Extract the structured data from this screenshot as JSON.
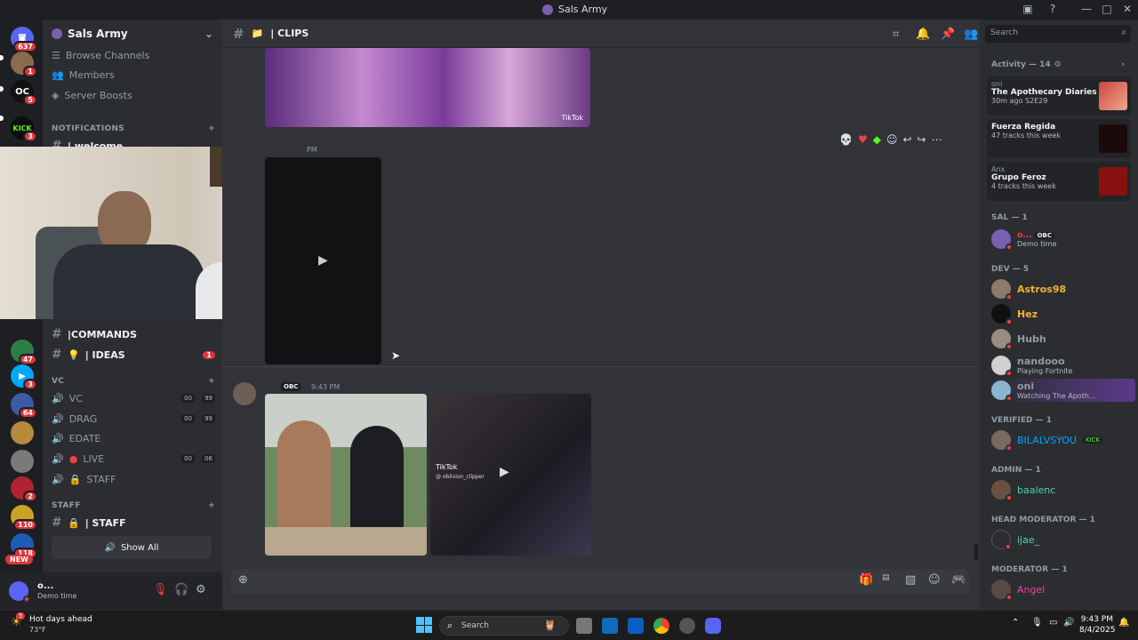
{
  "window": {
    "title": "Sals Army"
  },
  "server_badges": [
    "637",
    "1",
    "5",
    "3",
    "47",
    "3",
    "64",
    "2",
    "110",
    "118"
  ],
  "server_new_label": "NEW",
  "server": {
    "name": "Sals Army"
  },
  "nav": {
    "browse": "Browse Channels",
    "members": "Members",
    "boosts": "Server Boosts"
  },
  "categories": {
    "notifications": "NOTIFICATIONS",
    "vc": "VC",
    "staff": "STAFF"
  },
  "channels": {
    "welcome": "| welcome",
    "commands": "|COMMANDS",
    "ideas": "| IDEAS",
    "ideas_badge": "1",
    "vc": "VC",
    "drag": "DRAG",
    "edate": "EDATE",
    "live": "LIVE",
    "staff_voice": "STAFF",
    "staff_text": "| STAFF",
    "show_all": "Show All",
    "vc_pills": [
      "00",
      "99"
    ],
    "drag_pills": [
      "00",
      "99"
    ],
    "live_pills": [
      "00",
      "06"
    ]
  },
  "user": {
    "name": "o...",
    "status": "Demo time"
  },
  "chat": {
    "channel": "| CLIPS",
    "time_partial": "PM",
    "msg2_tag": "OBC",
    "msg2_time": "9:43 PM",
    "tiktok_label": "TikTok",
    "tiktok_handle": "@ oblivion_clipper"
  },
  "search": {
    "placeholder": "Search"
  },
  "activity": {
    "header": "Activity — 14",
    "items": [
      {
        "user": "oni",
        "title": "The Apothecary Diaries",
        "sub1": "30m ago",
        "sub2": "S2E29"
      },
      {
        "user": "",
        "title": "Fuerza Regida",
        "sub1": "47 tracks this week",
        "sub2": ""
      },
      {
        "user": "Anx",
        "title": "Grupo Feroz",
        "sub1": "4 tracks this week",
        "sub2": ""
      }
    ]
  },
  "member_groups": {
    "sal": "SAL — 1",
    "dev": "DEV — 5",
    "verified": "VERIFIED — 1",
    "admin": "ADMIN — 1",
    "head_mod": "HEAD MODERATOR — 1",
    "moderator": "MODERATOR — 1"
  },
  "members": {
    "sal": {
      "name": "o...",
      "tag": "OBC",
      "status": "Demo time"
    },
    "dev": [
      {
        "name": "Astros98",
        "status": "",
        "color": "#f0b232"
      },
      {
        "name": "Hez",
        "status": "",
        "color": "#f0b232"
      },
      {
        "name": "Hubh",
        "status": "",
        "color": "#949ba4"
      },
      {
        "name": "nandooo",
        "status": "Playing Fortnite",
        "color": "#949ba4"
      },
      {
        "name": "oni",
        "status": "Watching The Apoth...",
        "color": "#949ba4"
      }
    ],
    "verified": {
      "name": "BILALVSYOU",
      "tag": "KICK"
    },
    "admin": {
      "name": "baalenc"
    },
    "head_mod": {
      "name": "ijae_"
    },
    "moderator": {
      "name": "Angel"
    }
  },
  "taskbar": {
    "weather_title": "Hot days ahead",
    "weather_temp": "73°F",
    "search": "Search",
    "time": "9:43 PM",
    "date": "8/4/2025",
    "weather_badge": "5"
  },
  "colors": {
    "accent": "#5865f2",
    "dnd": "#f23f43",
    "mention": "#da373c"
  }
}
